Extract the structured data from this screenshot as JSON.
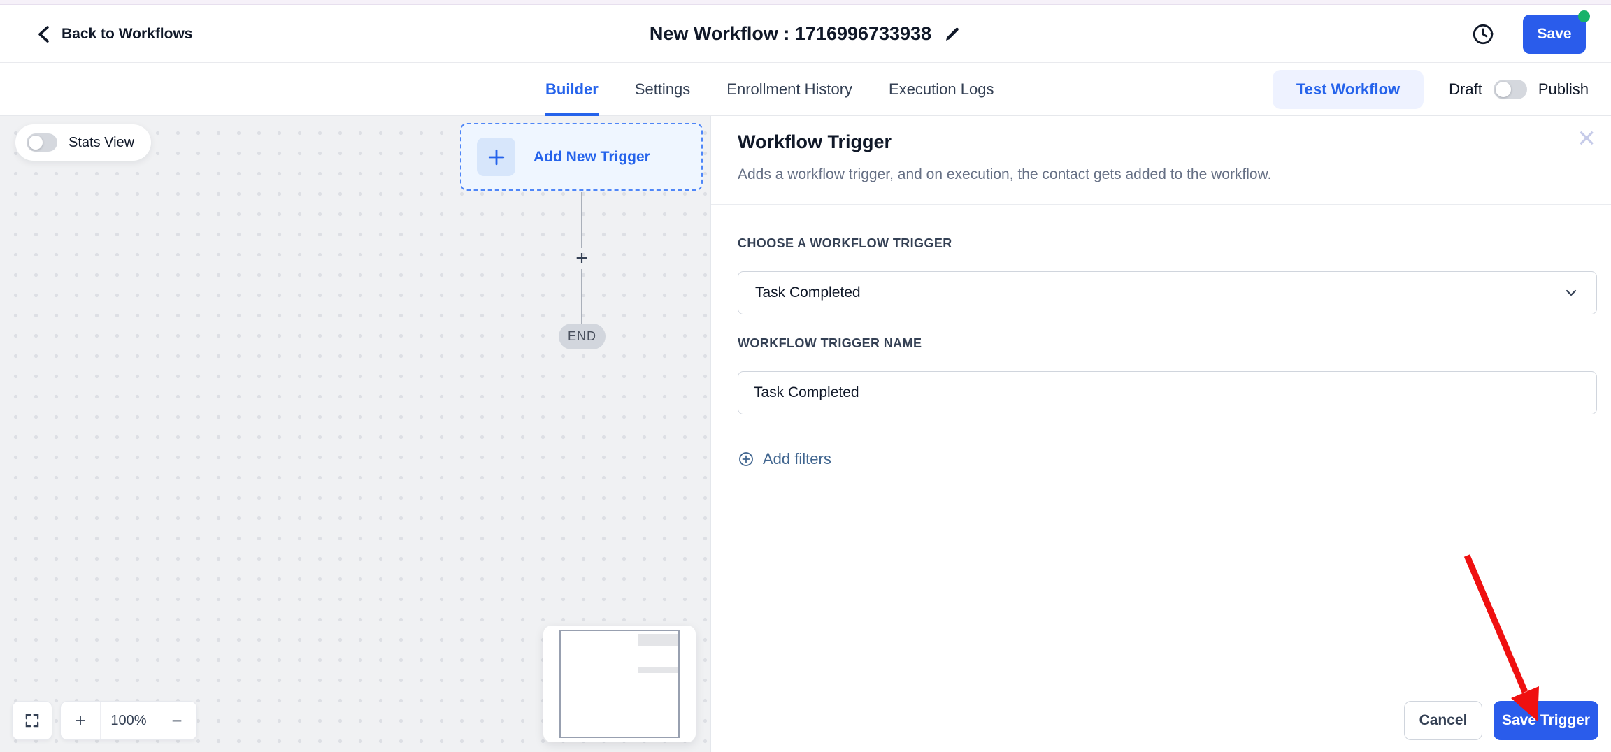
{
  "header": {
    "back_label": "Back to Workflows",
    "title": "New Workflow : 1716996733938",
    "save_label": "Save"
  },
  "tabs": {
    "items": [
      {
        "label": "Builder",
        "active": true
      },
      {
        "label": "Settings",
        "active": false
      },
      {
        "label": "Enrollment History",
        "active": false
      },
      {
        "label": "Execution Logs",
        "active": false
      }
    ],
    "test_workflow_label": "Test Workflow",
    "draft_label": "Draft",
    "publish_label": "Publish"
  },
  "canvas": {
    "stats_view_label": "Stats View",
    "add_trigger_label": "Add New Trigger",
    "connector_plus": "+",
    "end_label": "END",
    "zoom_in": "+",
    "zoom_level": "100%",
    "zoom_out": "−"
  },
  "panel": {
    "title": "Workflow Trigger",
    "description": "Adds a workflow trigger, and on execution, the contact gets added to the workflow.",
    "close_icon": "×",
    "trigger_select": {
      "label": "CHOOSE A WORKFLOW TRIGGER",
      "value": "Task Completed"
    },
    "trigger_name": {
      "label": "WORKFLOW TRIGGER NAME",
      "value": "Task Completed"
    },
    "add_filters_label": "Add filters",
    "footer": {
      "cancel_label": "Cancel",
      "save_label": "Save Trigger"
    }
  },
  "colors": {
    "accent": "#2a5ceb",
    "accent_text": "#2563eb",
    "test_workflow_bg": "#eef2ff",
    "green_dot": "#17b26a",
    "arrow_red": "#ef1010"
  }
}
